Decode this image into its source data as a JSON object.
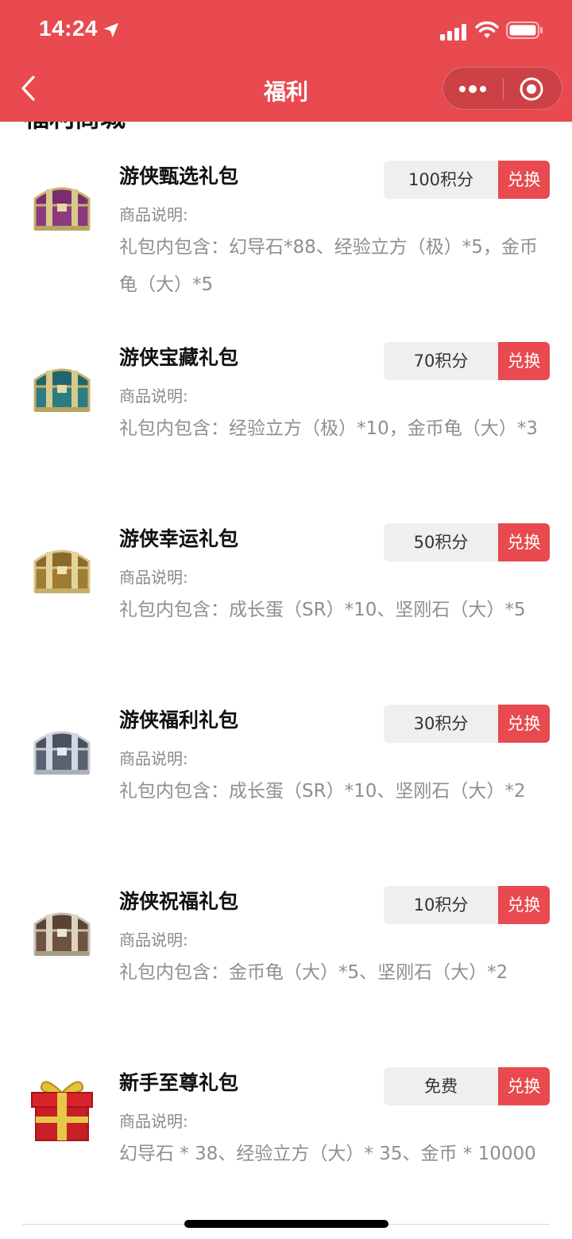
{
  "status_bar": {
    "time": "14:24",
    "icons": [
      "location-arrow-icon",
      "signal-icon",
      "wifi-icon",
      "battery-icon"
    ]
  },
  "nav": {
    "title": "福利",
    "back_icon": "chevron-left-icon",
    "more_icon": "more-dots-icon",
    "close_icon": "target-circle-icon"
  },
  "section": {
    "title": "福利商城"
  },
  "colors": {
    "brand_red": "#e84a4f",
    "price_bg": "#efefef",
    "desc_gray": "#8f8f8f"
  },
  "items": [
    {
      "name": "游侠甄选礼包",
      "desc_label": "商品说明:",
      "desc": "礼包内包含：幻导石*88、经验立方（极）*5，金币龟（大）*5",
      "price": "100积分",
      "action": "兑换",
      "icon": "purple-treasure-chest-icon"
    },
    {
      "name": "游侠宝藏礼包",
      "desc_label": "商品说明:",
      "desc": "礼包内包含：经验立方（极）*10，金币龟（大）*3",
      "price": "70积分",
      "action": "兑换",
      "icon": "teal-treasure-chest-icon"
    },
    {
      "name": "游侠幸运礼包",
      "desc_label": "商品说明:",
      "desc": "礼包内包含：成长蛋（SR）*10、坚刚石（大）*5",
      "price": "50积分",
      "action": "兑换",
      "icon": "gold-treasure-chest-icon"
    },
    {
      "name": "游侠福利礼包",
      "desc_label": "商品说明:",
      "desc": "礼包内包含：成长蛋（SR）*10、坚刚石（大）*2",
      "price": "30积分",
      "action": "兑换",
      "icon": "silver-treasure-chest-icon"
    },
    {
      "name": "游侠祝福礼包",
      "desc_label": "商品说明:",
      "desc": "礼包内包含：金币龟（大）*5、坚刚石（大）*2",
      "price": "10积分",
      "action": "兑换",
      "icon": "bronze-treasure-chest-icon"
    },
    {
      "name": "新手至尊礼包",
      "desc_label": "商品说明:",
      "desc": "幻导石 * 38、经验立方（大）* 35、金币 * 10000",
      "price": "免费",
      "action": "兑换",
      "icon": "red-gift-box-icon"
    }
  ]
}
